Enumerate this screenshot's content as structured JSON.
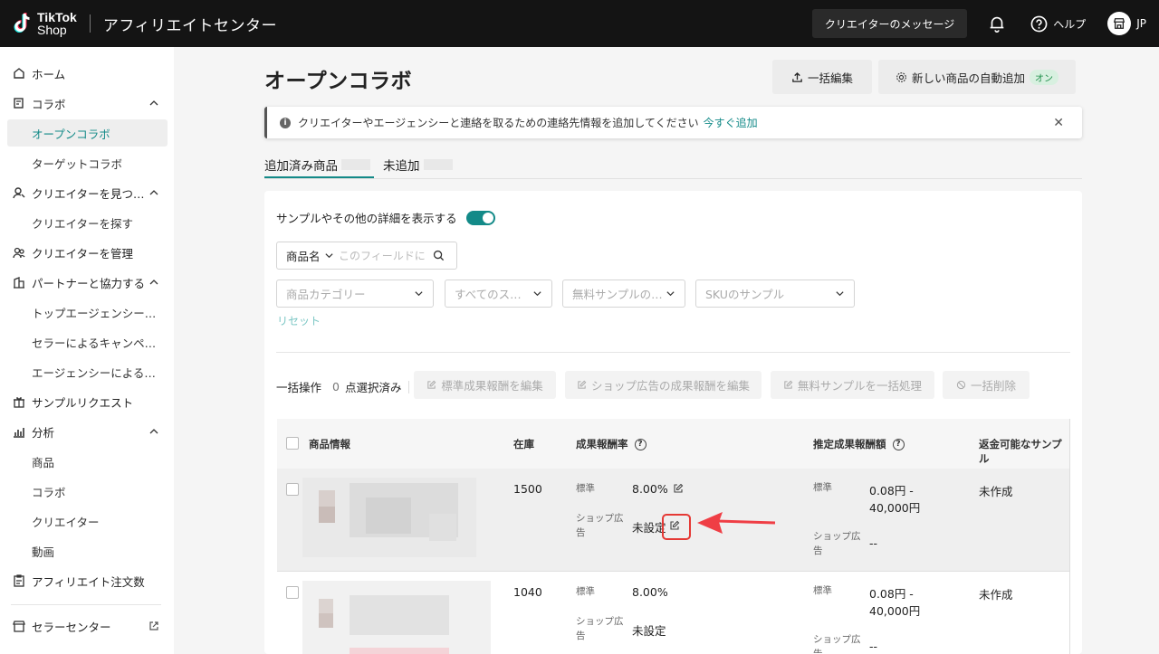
{
  "topbar": {
    "logo_line1": "TikTok",
    "logo_line2": "Shop",
    "title": "アフィリエイトセンター",
    "message_button": "クリエイターのメッセージ",
    "help": "ヘルプ",
    "region": "JP"
  },
  "sidebar": {
    "home": "ホーム",
    "collab": "コラボ",
    "open_collab": "オープンコラボ",
    "target_collab": "ターゲットコラボ",
    "find_creators": "クリエイターを見つ…",
    "search_creators": "クリエイターを探す",
    "manage_creators": "クリエイターを管理",
    "partner": "パートナーと協力する",
    "top_agency": "トップエージェンシー…",
    "seller_campaign": "セラーによるキャンペ…",
    "agency_by": "エージェンシーによる…",
    "sample_request": "サンプルリクエスト",
    "analytics": "分析",
    "products": "商品",
    "collab_sub": "コラボ",
    "creators": "クリエイター",
    "videos": "動画",
    "affiliate_orders": "アフィリエイト注文数",
    "seller_center": "セラーセンター"
  },
  "page": {
    "title": "オープンコラボ",
    "bulk_edit": "一括編集",
    "auto_add": "新しい商品の自動追加",
    "auto_add_badge": "オン",
    "notice_text": "クリエイターやエージェンシーと連絡を取るための連絡先情報を追加してください",
    "notice_link": "今すぐ追加",
    "tab_added": "追加済み商品",
    "tab_not_added": "未追加"
  },
  "filters": {
    "show_details": "サンプルやその他の詳細を表示する",
    "search_type": "商品名",
    "search_placeholder": "このフィールドに",
    "category": "商品カテゴリー",
    "status": "すべてのス…",
    "free_sample": "無料サンプルの…",
    "sku_sample": "SKUのサンプル",
    "reset": "リセット"
  },
  "bulk": {
    "label": "一括操作",
    "count": "0",
    "selected": "点選択済み",
    "edit_standard": "標準成果報酬を編集",
    "edit_shop_ads": "ショップ広告の成果報酬を編集",
    "free_sample_bulk": "無料サンプルを一括処理",
    "bulk_delete": "一括削除"
  },
  "table": {
    "headers": {
      "product_info": "商品情報",
      "stock": "在庫",
      "commission_rate": "成果報酬率",
      "est_commission": "推定成果報酬額",
      "refundable_sample": "返金可能なサンプル"
    },
    "rows": [
      {
        "stock": "1500",
        "standard_label": "標準",
        "standard_rate": "8.00%",
        "shop_ads_label": "ショップ広告",
        "shop_ads_rate": "未設定",
        "est_standard_label": "標準",
        "est_standard_value_1": "0.08円 -",
        "est_standard_value_2": "40,000円",
        "est_shop_ads_label": "ショップ広告",
        "est_shop_ads_value": "--",
        "sample": "未作成"
      },
      {
        "stock": "1040",
        "standard_label": "標準",
        "standard_rate": "8.00%",
        "shop_ads_label": "ショップ広告",
        "shop_ads_rate": "未設定",
        "est_standard_label": "標準",
        "est_standard_value_1": "0.08円 -",
        "est_standard_value_2": "40,000円",
        "est_shop_ads_label": "ショップ広告",
        "est_shop_ads_value": "--",
        "sample": "未作成"
      }
    ]
  },
  "colors": {
    "accent": "#138a88",
    "topbar": "#141414",
    "highlight": "#e53935"
  }
}
